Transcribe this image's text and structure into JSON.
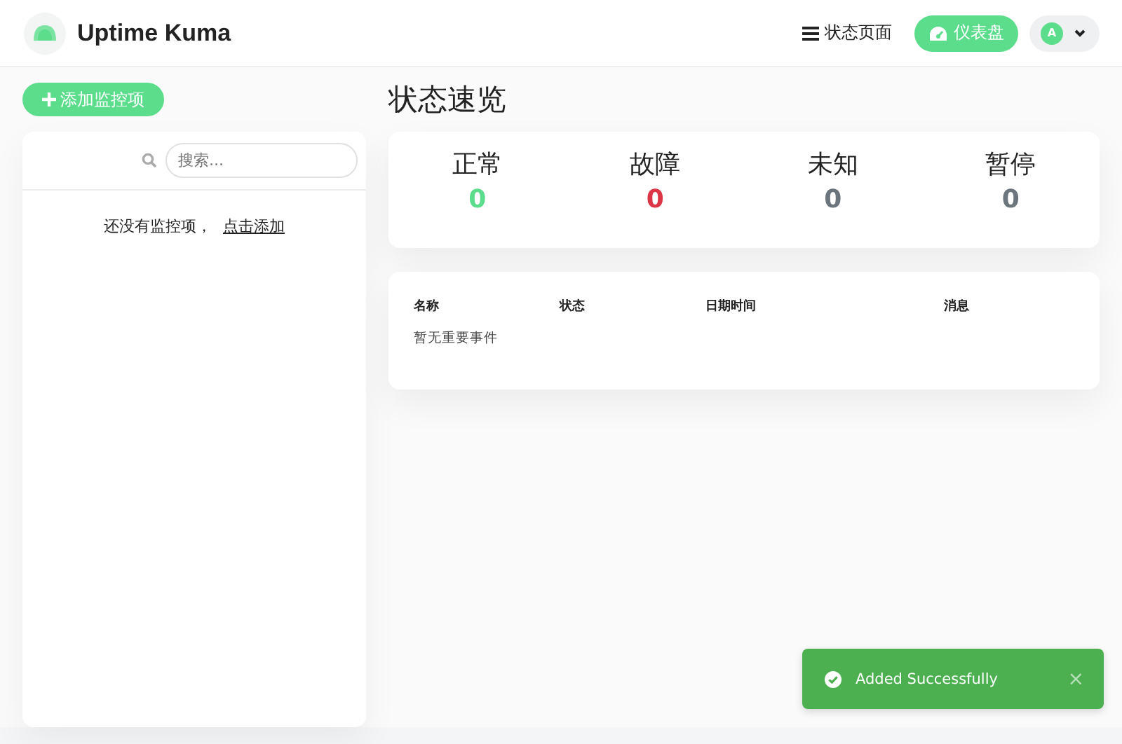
{
  "header": {
    "brand": "Uptime Kuma",
    "nav": [
      {
        "kind": "status",
        "label": "状态页面",
        "selected": false
      },
      {
        "kind": "dashboard",
        "label": "仪表盘",
        "selected": true
      }
    ],
    "avatar": "A"
  },
  "sidebar": {
    "add_button": "添加监控项",
    "search": {
      "placeholder": "搜索..."
    },
    "empty_text": "还没有监控项，",
    "empty_link": "点击添加"
  },
  "overview": {
    "title": "状态速览",
    "stats": [
      {
        "label": "正常",
        "value": "0",
        "color": "#5cdd8b"
      },
      {
        "label": "故障",
        "value": "0",
        "color": "#dc3545"
      },
      {
        "label": "未知",
        "value": "0",
        "color": "#6c757d"
      },
      {
        "label": "暂停",
        "value": "0",
        "color": "#6c757d"
      }
    ]
  },
  "events": {
    "columns": [
      "名称",
      "状态",
      "日期时间",
      "消息"
    ],
    "empty": "暂无重要事件"
  },
  "toast": {
    "message": "Added Successfully",
    "close": "×"
  }
}
